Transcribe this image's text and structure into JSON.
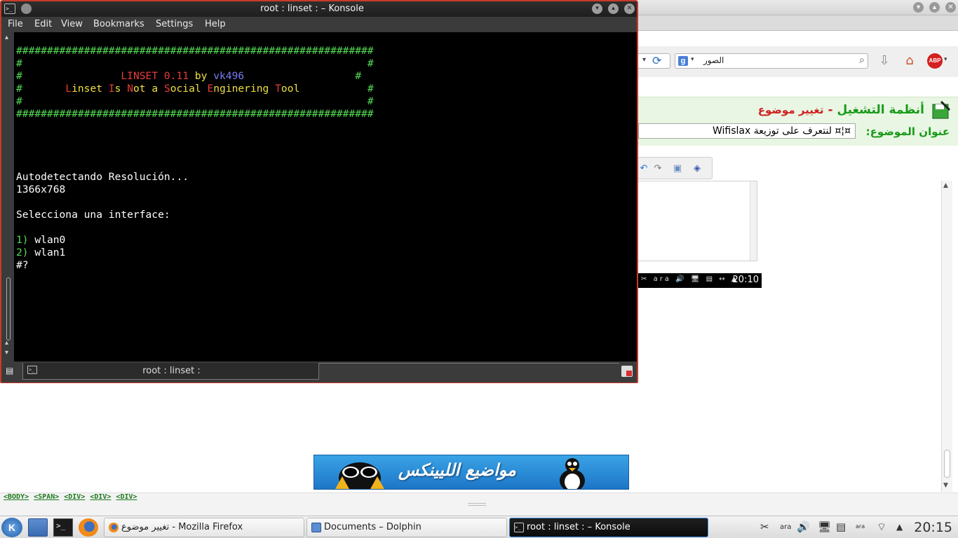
{
  "firefox": {
    "search_query": "الصور",
    "search_engine_icon": "g",
    "abp_label": "ABP",
    "forum_category": "أنظمة التشغيل",
    "forum_separator": "-",
    "forum_action": "تغيير موضوع",
    "subject_label": "عنوان الموضوع:",
    "subject_value": "¤¦¤ لنتعرف على توزيعة Wifislax",
    "tray_time": "20:10",
    "tray_lang": "ara",
    "banner_text": "مواضيع الليينكس",
    "breadcrumbs": [
      "<BODY>",
      "<SPAN>",
      "<DIV>",
      "<DIV>",
      "<DIV>"
    ]
  },
  "konsole": {
    "title": "root : linset :  – Konsole",
    "menu": [
      "File",
      "Edit",
      "View",
      "Bookmarks",
      "Settings",
      "Help"
    ],
    "tab_label": "root : linset :",
    "terminal": {
      "hash_border": "##########################################################",
      "hash": "#",
      "app_name": "LINSET 0.11",
      "by": "by",
      "author": "vk496",
      "tagline_initials": [
        "L",
        "I",
        "N",
        "S",
        "E",
        "T"
      ],
      "tagline_words": [
        "inset ",
        "s ",
        "ot a ",
        "ocial ",
        "nginering ",
        "ool"
      ],
      "detect_line": "Autodetectando Resolución...",
      "resolution": "1366x768",
      "select_prompt": "Selecciona una interface:",
      "options": [
        {
          "num": "1)",
          "name": "wlan0"
        },
        {
          "num": "2)",
          "name": "wlan1"
        }
      ],
      "prompt": "#?"
    }
  },
  "taskbar": {
    "tasks": [
      {
        "label": "تغيير موضوع - Mozilla Firefox"
      },
      {
        "label": "Documents – Dolphin"
      },
      {
        "label": "root : linset :  – Konsole"
      }
    ],
    "tray_lang": "ara",
    "tray_lang2": "ara",
    "clock": "20:15",
    "kmenu_label": "K"
  }
}
